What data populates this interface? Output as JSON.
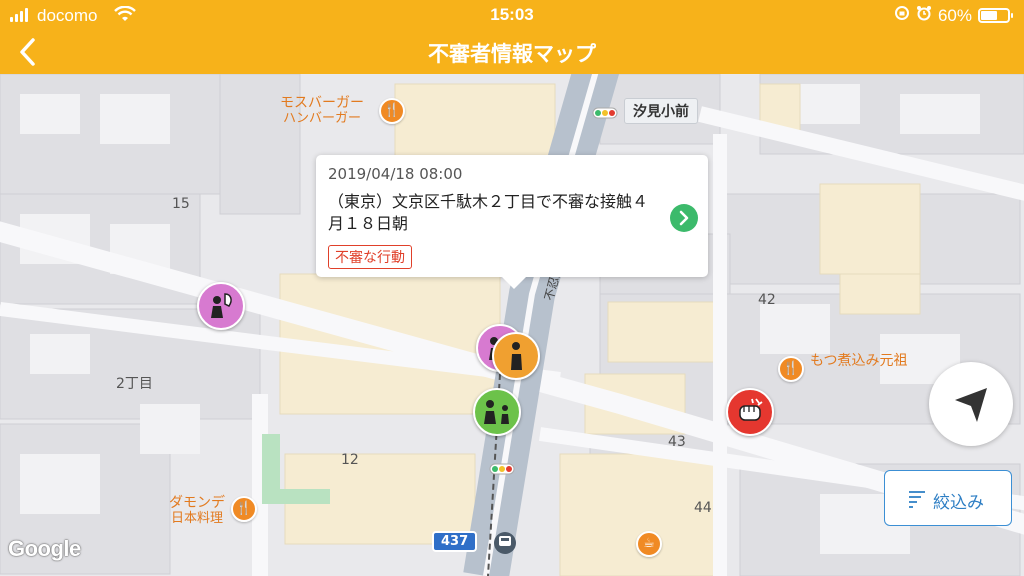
{
  "status_bar": {
    "carrier": "docomo",
    "time": "15:03",
    "battery": "60%",
    "battery_level": 0.6
  },
  "nav": {
    "title": "不審者情報マップ",
    "back_icon": "chevron-left-icon"
  },
  "map": {
    "block_labels": [
      "15",
      "2丁目",
      "12",
      "42",
      "43",
      "44"
    ],
    "pois": {
      "mos_burger": {
        "name": "モスバーガー",
        "category": "ハンバーガー"
      },
      "motsuni": {
        "name": "もつ煮込み元祖"
      },
      "damonde": {
        "name": "ダモンデ",
        "category": "日本料理"
      }
    },
    "station": "汐見小前",
    "street": "不忍通り",
    "route_shield": "437",
    "attribution": "Google"
  },
  "callout": {
    "date": "2019/04/18 08:00",
    "text": "（東京）文京区千駄木２丁目で不審な接触４月１８日朝",
    "tag": "不審な行動"
  },
  "buttons": {
    "filter_label": "絞込み"
  },
  "colors": {
    "brand": "#f7b21a",
    "pin_pink": "#d77ad0",
    "pin_orange": "#f0a030",
    "pin_green": "#6cc24a",
    "pin_red": "#e5372f",
    "go_button": "#3cba6b",
    "tag": "#e0402a",
    "filter": "#2d7ec4"
  }
}
